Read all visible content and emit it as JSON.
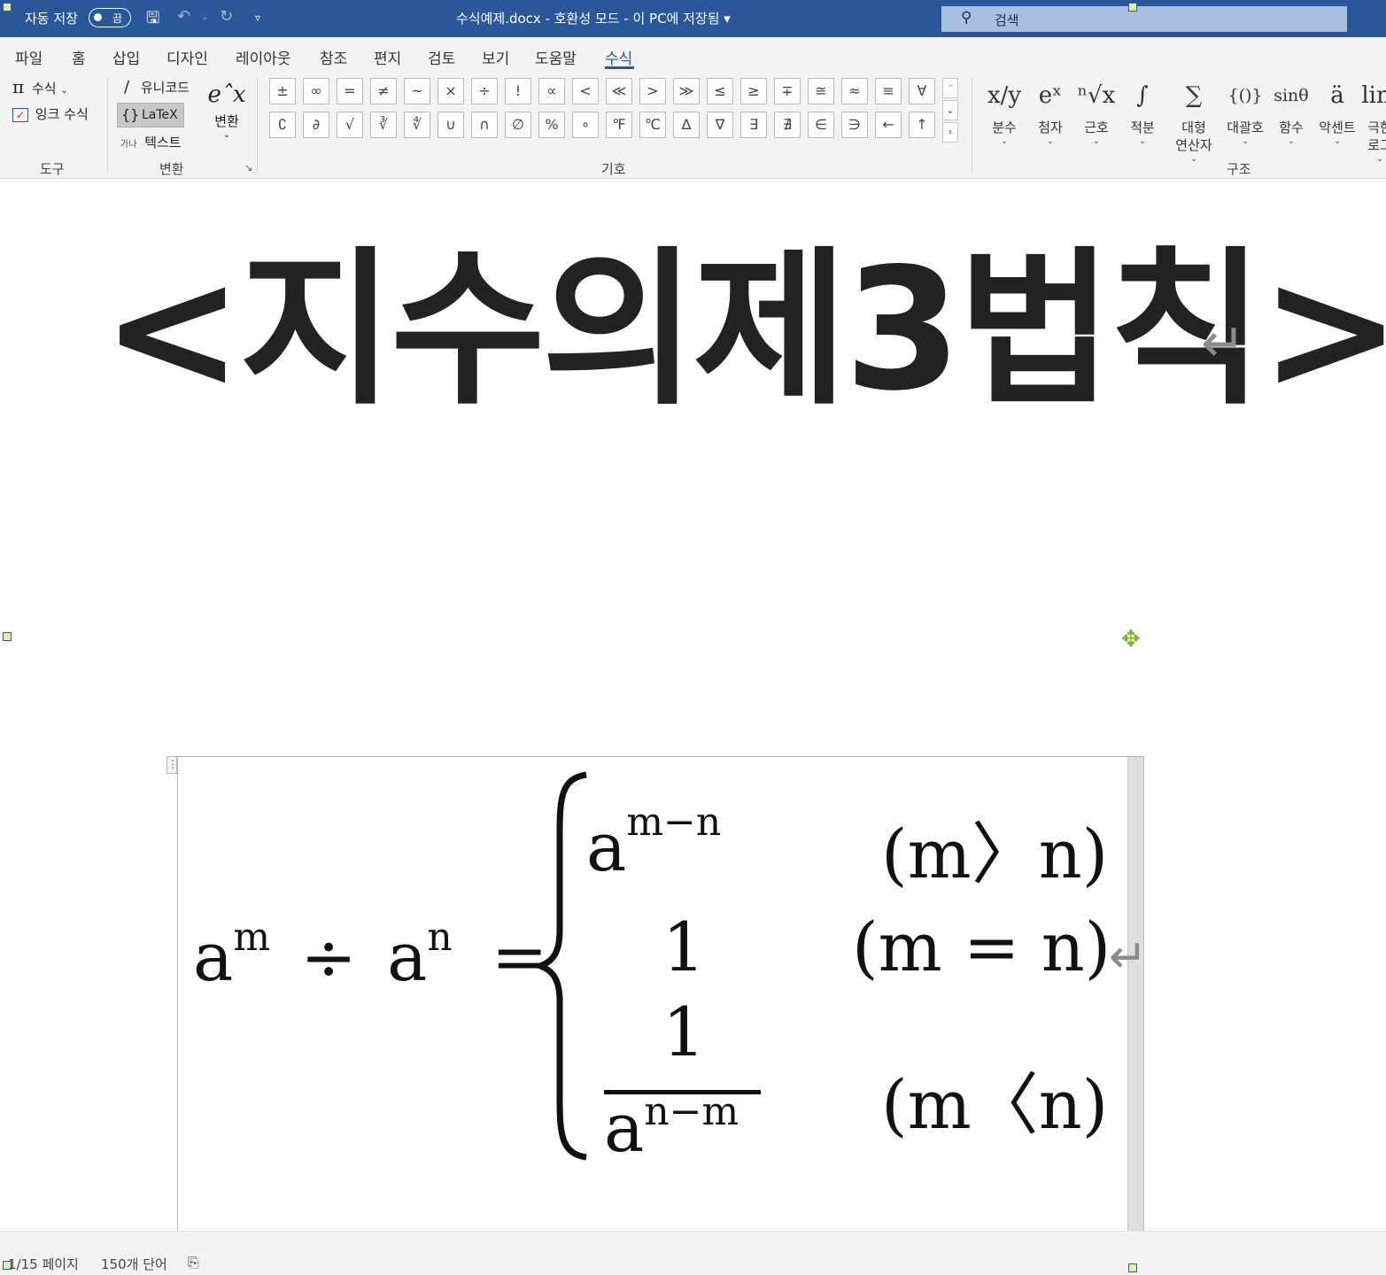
{
  "titlebar": {
    "autosave_label": "자동 저장",
    "autosave_state": "끔",
    "document_title": "수식예제.docx  -  호환성 모드  -  이 PC에 저장됨 ▾",
    "search_placeholder": "검색"
  },
  "tabs": [
    "파일",
    "홈",
    "삽입",
    "디자인",
    "레이아웃",
    "참조",
    "편지",
    "검토",
    "보기",
    "도움말",
    "수식"
  ],
  "ribbon": {
    "tools": {
      "equation_label": "수식",
      "ink_equation_label": "잉크 수식",
      "group_label": "도구"
    },
    "conversions": {
      "unicode_label": "유니코드",
      "latex_label": "LaTeX",
      "text_prefix": "가나",
      "text_label": "텍스트",
      "convert_label": "변환",
      "group_label": "변환"
    },
    "symbols": {
      "row1": [
        "±",
        "∞",
        "=",
        "≠",
        "~",
        "×",
        "÷",
        "!",
        "∝",
        "<",
        "≪",
        ">",
        "≫",
        "≤",
        "≥",
        "∓",
        "≅",
        "≈",
        "≡",
        "∀"
      ],
      "row2": [
        "∁",
        "∂",
        "√",
        "∛",
        "∜",
        "∪",
        "∩",
        "∅",
        "%",
        "∘",
        "℉",
        "℃",
        "∆",
        "∇",
        "∃",
        "∄",
        "∈",
        "∋",
        "←",
        "↑"
      ],
      "group_label": "기호"
    },
    "structures": {
      "items": [
        {
          "glyph": "x/y",
          "label": "분수"
        },
        {
          "glyph": "eˣ",
          "label": "첨자"
        },
        {
          "glyph": "ⁿ√x",
          "label": "근호"
        },
        {
          "glyph": "∫",
          "label": "적분"
        },
        {
          "glyph": "∑",
          "label": "대형\n연산자"
        },
        {
          "glyph": "{()}",
          "label": "대괄호"
        },
        {
          "glyph": "sinθ",
          "label": "함수"
        },
        {
          "glyph": "ä",
          "label": "악센트"
        },
        {
          "glyph": "lim",
          "label": "극한\n로그"
        }
      ],
      "group_label": "구조"
    }
  },
  "document": {
    "heading": "<지수의제3법칙>",
    "equation": {
      "lhs_base1": "a",
      "lhs_exp1": "m",
      "op": "÷",
      "lhs_base2": "a",
      "lhs_exp2": "n",
      "eq": "=",
      "case1_base": "a",
      "case1_exp": "m−n",
      "case1_cond": "(m〉n)",
      "case2_value": "1",
      "case2_cond": "(m = n)",
      "case3_num": "1",
      "case3_den_base": "a",
      "case3_den_exp": "n−m",
      "case3_cond": "(m〈n)"
    }
  },
  "statusbar": {
    "page": "1/15 페이지",
    "words": "150개 단어"
  }
}
